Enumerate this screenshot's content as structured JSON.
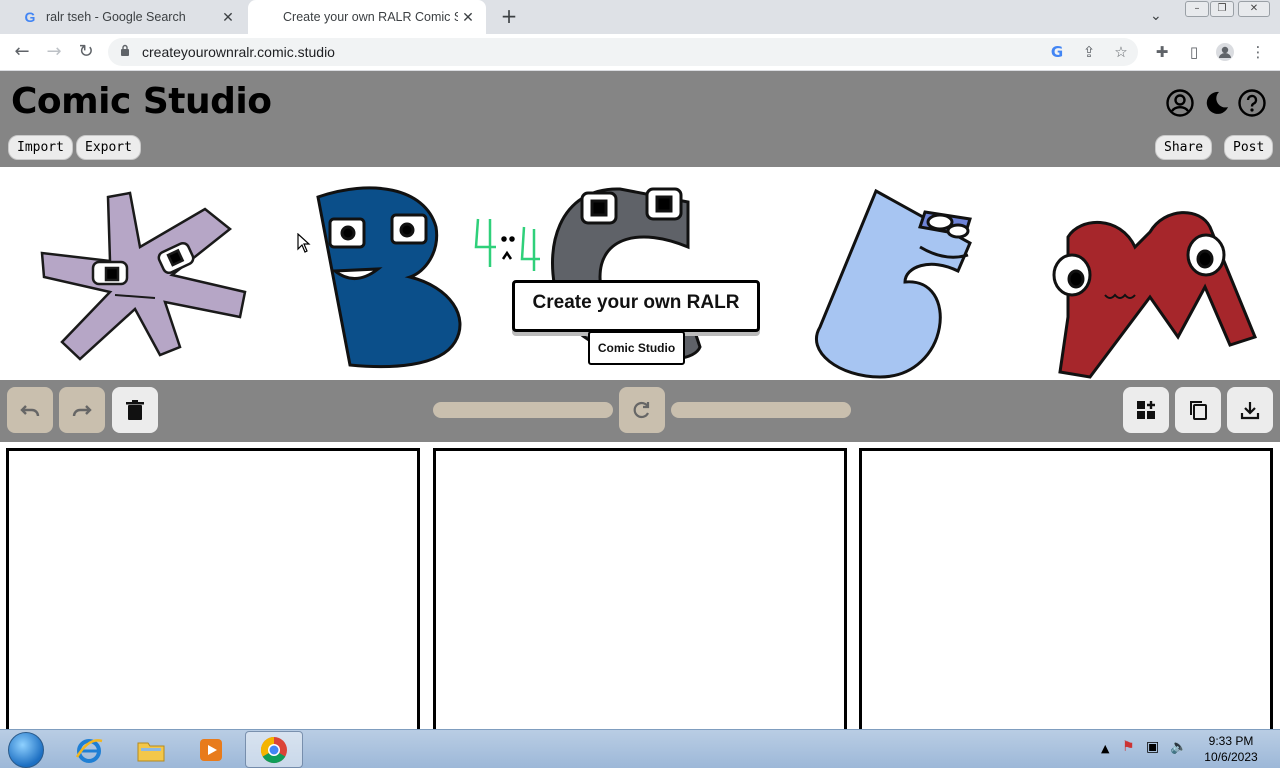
{
  "browser": {
    "tabs": [
      {
        "title": "ralr tseh - Google Search",
        "active": false,
        "favicon": "google-g-icon"
      },
      {
        "title": "Create your own RALR Comic Stu",
        "active": true,
        "favicon": "none"
      }
    ],
    "url": "createyourownralr.comic.studio"
  },
  "header": {
    "title": "Comic Studio",
    "import_label": "Import",
    "export_label": "Export",
    "share_label": "Share",
    "post_label": "Post"
  },
  "banner": {
    "headline": "Create your own RALR",
    "subtitle": "Comic Studio",
    "colors": {
      "asterisk": "#b6a6c6",
      "b": "#0b4f8a",
      "c": "#5f6268",
      "s": "#a7c5f2",
      "m": "#a6262b",
      "four": "#2fd07a"
    }
  },
  "editor": {
    "tools": [
      "undo-icon",
      "redo-icon",
      "trash-icon",
      "refresh-icon",
      "add-panel-icon",
      "copy-icon",
      "download-icon"
    ]
  },
  "taskbar": {
    "time": "9:33 PM",
    "date": "10/6/2023"
  },
  "colors": {
    "header_bg": "#858585",
    "button_bg": "#ececec",
    "disabled_bg": "#c9bfae"
  }
}
